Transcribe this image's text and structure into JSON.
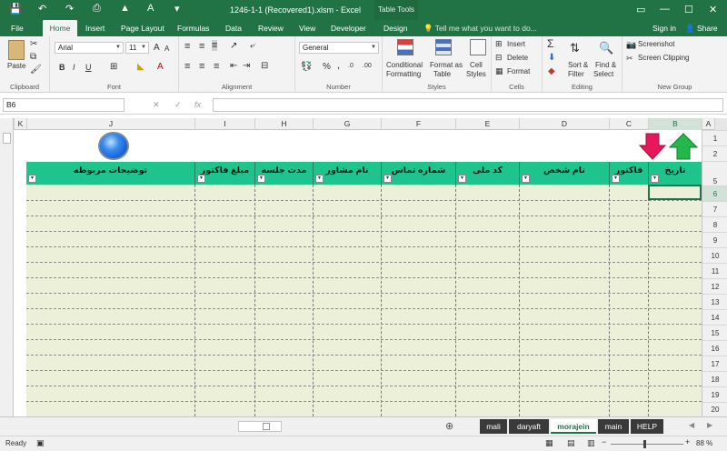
{
  "window": {
    "title": "1246-1-1 (Recovered1).xlsm - Excel",
    "context_tab": "Table Tools",
    "controls": {
      "restore": "▭",
      "minimize": "—",
      "maximize": "☐",
      "close": "✕"
    }
  },
  "ribbon_tabs": [
    "File",
    "Home",
    "Insert",
    "Page Layout",
    "Formulas",
    "Data",
    "Review",
    "View",
    "Developer",
    "Design"
  ],
  "active_tab": "Home",
  "tell_me": "Tell me what you want to do...",
  "account": {
    "sign_in": "Sign in",
    "share": "Share"
  },
  "ribbon": {
    "clipboard": {
      "label": "Clipboard",
      "paste": "Paste"
    },
    "font": {
      "label": "Font",
      "name": "Arial",
      "size": "11",
      "bold": "B",
      "italic": "I",
      "underline": "U",
      "grow": "A",
      "shrink": "A"
    },
    "alignment": {
      "label": "Alignment"
    },
    "number": {
      "label": "Number",
      "format": "General",
      "percent": "%",
      "comma": ",",
      "dec_inc": ".0",
      "dec_dec": ".00"
    },
    "styles": {
      "label": "Styles",
      "conditional": "Conditional",
      "formatting": "Formatting",
      "format_as": "Format as",
      "table": "Table",
      "cell": "Cell",
      "styles": "Styles"
    },
    "cells": {
      "label": "Cells",
      "insert": "Insert",
      "delete": "Delete",
      "format": "Format"
    },
    "editing": {
      "label": "Editing",
      "sort": "Sort &",
      "filter": "Filter",
      "find": "Find &",
      "select": "Select",
      "sigma": "Σ"
    },
    "new_group": {
      "label": "New Group",
      "screenshot": "Screenshot",
      "screen_clipping": "Screen Clipping"
    }
  },
  "formula_bar": {
    "name_box": "B6",
    "fx": "fx",
    "value": ""
  },
  "columns": [
    "A",
    "B",
    "C",
    "D",
    "E",
    "F",
    "G",
    "H",
    "I",
    "J",
    "K"
  ],
  "rows": [
    "1",
    "2",
    "5",
    "6",
    "7",
    "8",
    "9",
    "10",
    "11",
    "12",
    "13",
    "14",
    "15",
    "16",
    "17",
    "18",
    "19",
    "20"
  ],
  "table_headers": [
    "تاریخ",
    "فاکتور",
    "نام شخص",
    "کد ملی",
    "شماره تماس",
    "نام مشاور",
    "مدت جلسه",
    "مبلغ فاکتور",
    "توضیحات مربوطه"
  ],
  "sheet_tabs": [
    "mali",
    "daryaft",
    "morajein",
    "main",
    "HELP"
  ],
  "active_sheet": "morajein",
  "status": {
    "ready": "Ready",
    "zoom": "88 %"
  },
  "colors": {
    "excel_green": "#217346",
    "table_header": "#1ec48c",
    "table_body": "#ecf0d8",
    "arrow_down": "#e8165a",
    "arrow_up": "#22b84a",
    "orb": "#1f6fe0"
  }
}
